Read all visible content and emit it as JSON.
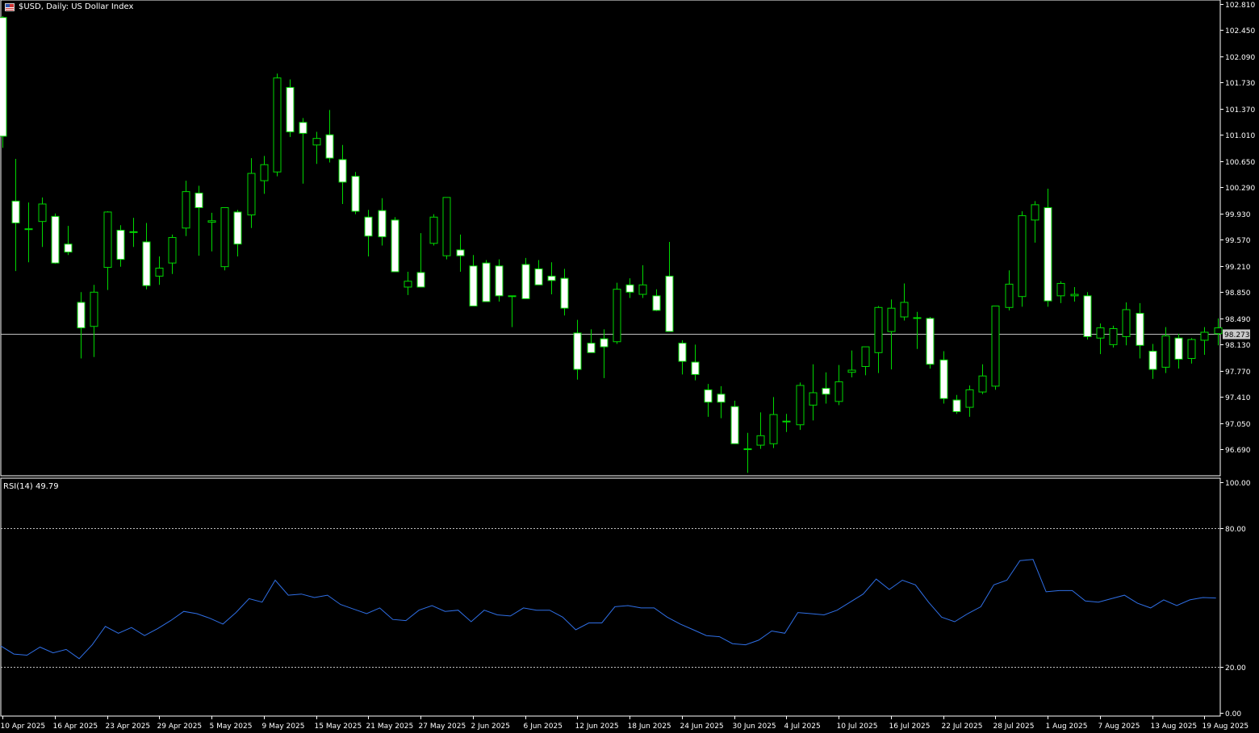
{
  "header": {
    "symbol": "$USD",
    "timeframe": "Daily",
    "description": "US Dollar Index",
    "title": "$USD, Daily:  US Dollar Index"
  },
  "rsi_label": "RSI(14) 49.79",
  "current_price_label": "98.273",
  "colors": {
    "background": "#000000",
    "candle_wick": "#00d800",
    "bull_fill": "#000000",
    "bear_fill": "#ffffff",
    "price_line": "#c0c0c0",
    "rsi_line": "#2f6fe6",
    "axis_text": "#ffffff"
  },
  "chart_data": [
    {
      "type": "candlestick",
      "title": "$USD, Daily:  US Dollar Index",
      "ylim": [
        96.33,
        102.86
      ],
      "y_ticks": [
        "102.810",
        "102.450",
        "102.090",
        "101.730",
        "101.370",
        "101.010",
        "100.650",
        "100.290",
        "99.930",
        "99.570",
        "99.210",
        "98.850",
        "98.490",
        "98.130",
        "97.770",
        "97.410",
        "97.050",
        "96.690"
      ],
      "x_tick_labels": [
        "10 Apr 2025",
        "16 Apr 2025",
        "23 Apr 2025",
        "29 Apr 2025",
        "5 May 2025",
        "9 May 2025",
        "15 May 2025",
        "21 May 2025",
        "27 May 2025",
        "2 Jun 2025",
        "6 Jun 2025",
        "12 Jun 2025",
        "18 Jun 2025",
        "24 Jun 2025",
        "30 Jun 2025",
        "4 Jul 2025",
        "10 Jul 2025",
        "16 Jul 2025",
        "22 Jul 2025",
        "28 Jul 2025",
        "1 Aug 2025",
        "7 Aug 2025",
        "13 Aug 2025",
        "19 Aug 2025"
      ],
      "last_price": 98.273,
      "ohlc": [
        [
          102.62,
          102.64,
          100.83,
          100.99
        ],
        [
          100.1,
          100.68,
          99.14,
          99.8
        ],
        [
          99.72,
          100.08,
          99.26,
          99.71
        ],
        [
          99.82,
          100.15,
          99.47,
          100.06
        ],
        [
          99.89,
          99.93,
          99.24,
          99.25
        ],
        [
          99.51,
          99.76,
          99.36,
          99.4
        ],
        [
          98.71,
          98.85,
          97.94,
          98.36
        ],
        [
          98.38,
          98.95,
          97.96,
          98.85
        ],
        [
          99.19,
          99.96,
          98.88,
          99.95
        ],
        [
          99.7,
          99.77,
          99.2,
          99.3
        ],
        [
          99.67,
          99.87,
          99.47,
          99.68
        ],
        [
          99.54,
          99.8,
          98.89,
          98.94
        ],
        [
          99.07,
          99.34,
          98.95,
          99.18
        ],
        [
          99.25,
          99.64,
          99.1,
          99.6
        ],
        [
          99.73,
          100.38,
          99.62,
          100.23
        ],
        [
          100.21,
          100.31,
          99.35,
          100.01
        ],
        [
          99.81,
          99.94,
          99.41,
          99.83
        ],
        [
          99.2,
          99.78,
          99.15,
          100.01
        ],
        [
          99.95,
          99.98,
          99.34,
          99.51
        ],
        [
          99.91,
          100.69,
          99.73,
          100.48
        ],
        [
          100.38,
          100.72,
          100.2,
          100.6
        ],
        [
          100.5,
          101.85,
          100.44,
          101.79
        ],
        [
          101.66,
          101.77,
          100.98,
          101.05
        ],
        [
          101.18,
          101.24,
          100.34,
          101.03
        ],
        [
          100.87,
          101.05,
          100.61,
          100.96
        ],
        [
          101.01,
          101.35,
          100.63,
          100.69
        ],
        [
          100.67,
          100.87,
          100.06,
          100.36
        ],
        [
          100.44,
          100.5,
          99.92,
          99.96
        ],
        [
          99.88,
          99.98,
          99.34,
          99.62
        ],
        [
          99.97,
          100.14,
          99.49,
          99.61
        ],
        [
          99.84,
          99.88,
          99.14,
          99.13
        ],
        [
          98.92,
          99.13,
          98.81,
          99.0
        ],
        [
          99.12,
          99.66,
          98.97,
          98.92
        ],
        [
          99.52,
          99.92,
          99.49,
          99.88
        ],
        [
          99.35,
          100.12,
          99.3,
          100.15
        ],
        [
          99.43,
          99.64,
          99.13,
          99.35
        ],
        [
          99.21,
          99.36,
          98.66,
          98.66
        ],
        [
          99.25,
          99.29,
          98.73,
          98.72
        ],
        [
          99.21,
          99.3,
          98.72,
          98.8
        ],
        [
          98.8,
          98.8,
          98.37,
          98.79
        ],
        [
          99.23,
          99.32,
          98.79,
          98.76
        ],
        [
          99.17,
          99.29,
          98.95,
          98.95
        ],
        [
          99.07,
          99.26,
          98.82,
          99.01
        ],
        [
          99.04,
          99.17,
          98.53,
          98.63
        ],
        [
          98.29,
          98.47,
          97.65,
          97.79
        ],
        [
          98.15,
          98.34,
          98.03,
          98.02
        ],
        [
          98.21,
          98.34,
          97.67,
          98.1
        ],
        [
          98.17,
          98.98,
          98.14,
          98.89
        ],
        [
          98.95,
          99.04,
          98.77,
          98.85
        ],
        [
          98.82,
          99.22,
          98.77,
          98.95
        ],
        [
          98.8,
          98.89,
          98.59,
          98.6
        ],
        [
          99.07,
          99.54,
          98.36,
          98.31
        ],
        [
          98.15,
          98.19,
          97.72,
          97.9
        ],
        [
          97.89,
          98.13,
          97.64,
          97.72
        ],
        [
          97.51,
          97.59,
          97.14,
          97.34
        ],
        [
          97.45,
          97.56,
          97.12,
          97.34
        ],
        [
          97.28,
          97.36,
          96.77,
          96.77
        ],
        [
          96.7,
          96.92,
          96.37,
          96.7
        ],
        [
          96.75,
          97.2,
          96.7,
          96.88
        ],
        [
          96.77,
          97.41,
          96.71,
          97.17
        ],
        [
          97.07,
          97.18,
          96.93,
          97.08
        ],
        [
          97.03,
          97.61,
          96.96,
          97.57
        ],
        [
          97.3,
          97.86,
          97.09,
          97.47
        ],
        [
          97.53,
          97.75,
          97.32,
          97.45
        ],
        [
          97.35,
          97.85,
          97.3,
          97.62
        ],
        [
          97.75,
          98.05,
          97.68,
          97.78
        ],
        [
          97.83,
          98.04,
          97.71,
          98.1
        ],
        [
          98.02,
          98.66,
          97.74,
          98.64
        ],
        [
          98.31,
          98.75,
          97.79,
          98.63
        ],
        [
          98.51,
          98.97,
          98.46,
          98.71
        ],
        [
          98.5,
          98.58,
          98.07,
          98.5
        ],
        [
          98.49,
          98.51,
          97.8,
          97.86
        ],
        [
          97.92,
          98.04,
          97.32,
          97.39
        ],
        [
          97.37,
          97.44,
          97.18,
          97.21
        ],
        [
          97.27,
          97.57,
          97.14,
          97.51
        ],
        [
          97.48,
          97.86,
          97.45,
          97.7
        ],
        [
          97.56,
          98.64,
          97.51,
          98.66
        ],
        [
          98.64,
          99.15,
          98.6,
          98.96
        ],
        [
          98.79,
          99.96,
          98.65,
          99.9
        ],
        [
          99.84,
          100.1,
          99.53,
          100.05
        ],
        [
          100.01,
          100.27,
          98.65,
          98.73
        ],
        [
          98.8,
          99.0,
          98.7,
          98.97
        ],
        [
          98.8,
          98.92,
          98.72,
          98.82
        ],
        [
          98.8,
          98.85,
          98.2,
          98.24
        ],
        [
          98.22,
          98.42,
          98.0,
          98.36
        ],
        [
          98.13,
          98.39,
          98.09,
          98.35
        ],
        [
          98.24,
          98.71,
          98.12,
          98.61
        ],
        [
          98.56,
          98.7,
          97.94,
          98.12
        ],
        [
          98.04,
          98.14,
          97.66,
          97.79
        ],
        [
          97.82,
          98.37,
          97.74,
          98.25
        ],
        [
          98.22,
          98.28,
          97.8,
          97.93
        ],
        [
          97.94,
          98.22,
          97.87,
          98.2
        ],
        [
          98.19,
          98.37,
          97.99,
          98.3
        ],
        [
          98.28,
          98.49,
          98.12,
          98.36
        ]
      ]
    },
    {
      "type": "line",
      "title": "RSI(14) 49.79",
      "ylim": [
        0,
        100
      ],
      "y_ticks": [
        "100.00",
        "80.00",
        "20.00",
        "0.00"
      ],
      "levels": [
        80,
        20
      ],
      "series": [
        {
          "values": [
            29.0,
            25.5,
            25.0,
            28.5,
            26.0,
            27.5,
            23.5,
            29.5,
            37.5,
            34.5,
            37.0,
            33.5,
            36.5,
            40.0,
            44.0,
            43.0,
            41.0,
            38.5,
            43.5,
            49.5,
            48.0,
            57.5,
            51.0,
            51.5,
            50.0,
            51.0,
            47.0,
            45.0,
            43.0,
            45.5,
            40.5,
            40.0,
            44.5,
            46.5,
            44.0,
            44.5,
            39.5,
            44.5,
            42.5,
            42.0,
            45.5,
            44.5,
            44.5,
            41.5,
            36.0,
            39.0,
            39.0,
            46.0,
            46.5,
            45.5,
            45.5,
            41.5,
            38.5,
            36.0,
            33.5,
            33.0,
            30.0,
            29.5,
            31.5,
            35.5,
            34.5,
            43.5,
            43.0,
            42.5,
            44.5,
            48.0,
            51.5,
            58.0,
            53.5,
            57.5,
            55.5,
            48.0,
            41.5,
            39.5,
            43.0,
            46.0,
            55.5,
            57.5,
            66.0,
            66.5,
            52.5,
            53.0,
            53.0,
            48.5,
            48.0,
            49.5,
            51.0,
            47.5,
            45.5,
            49.0,
            46.5,
            49.0,
            50.0,
            49.79
          ]
        }
      ]
    }
  ]
}
